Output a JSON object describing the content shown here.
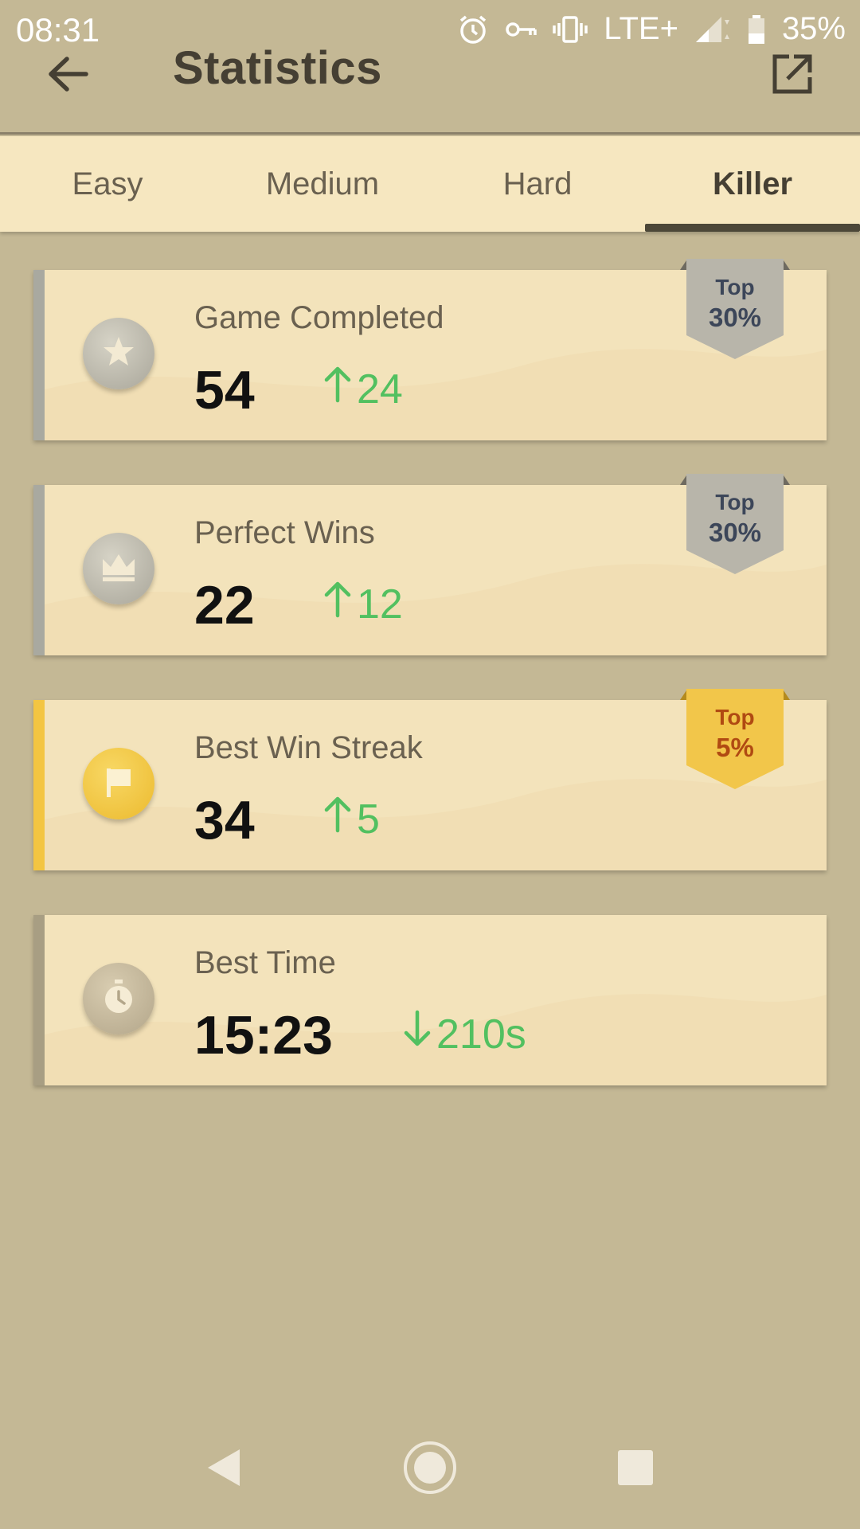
{
  "status_bar": {
    "time": "08:31",
    "network": "LTE+",
    "battery": "35%",
    "icons": [
      "alarm-icon",
      "vpn-key-icon",
      "vibrate-icon",
      "signal-icon",
      "battery-icon"
    ]
  },
  "app_bar": {
    "title": "Statistics",
    "back_icon": "arrow-left-icon",
    "share_icon": "open-external-icon"
  },
  "tabs": [
    {
      "label": "Easy",
      "active": false
    },
    {
      "label": "Medium",
      "active": false
    },
    {
      "label": "Hard",
      "active": false
    },
    {
      "label": "Killer",
      "active": true
    }
  ],
  "cards": [
    {
      "label": "Game Completed",
      "value": "54",
      "delta": "24",
      "delta_dir": "up",
      "icon": "star-icon",
      "accent": "#a9a9a0",
      "badge_top": "Top",
      "badge_pct": "30%",
      "badge_style": "silver"
    },
    {
      "label": "Perfect Wins",
      "value": "22",
      "delta": "12",
      "delta_dir": "up",
      "icon": "crown-icon",
      "accent": "#a9a9a0",
      "badge_top": "Top",
      "badge_pct": "30%",
      "badge_style": "silver"
    },
    {
      "label": "Best Win Streak",
      "value": "34",
      "delta": "5",
      "delta_dir": "up",
      "icon": "flag-icon",
      "accent": "#f3c542",
      "badge_top": "Top",
      "badge_pct": "5%",
      "badge_style": "gold"
    },
    {
      "label": "Best Time",
      "value": "15:23",
      "delta": "210s",
      "delta_dir": "down",
      "icon": "stopwatch-icon",
      "accent": "#a89e83",
      "badge_top": "",
      "badge_pct": "",
      "badge_style": "none"
    }
  ],
  "colors": {
    "background": "#c4b895",
    "card": "#f3e3bb",
    "delta_green": "#52c060",
    "tab_indicator": "#4c4738"
  },
  "nav_bar": {
    "back_icon": "nav-back-icon",
    "home_icon": "nav-home-icon",
    "recents_icon": "nav-recents-icon"
  }
}
